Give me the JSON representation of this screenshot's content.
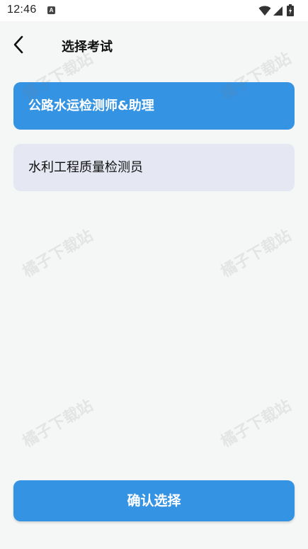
{
  "status_bar": {
    "time": "12:46",
    "notification_icon": "A",
    "icons": [
      "wifi-icon",
      "signal-icon",
      "battery-icon"
    ]
  },
  "header": {
    "back_icon": "chevron-left-icon",
    "title": "选择考试"
  },
  "options": [
    {
      "label": "公路水运检测师&助理",
      "selected": true
    },
    {
      "label": "水利工程质量检测员",
      "selected": false
    }
  ],
  "confirm_button": {
    "label": "确认选择"
  },
  "watermark": "橘子下载站",
  "colors": {
    "accent": "#3593e3",
    "option_background": "#e5e8f3",
    "page_background": "#f5f7f7"
  }
}
